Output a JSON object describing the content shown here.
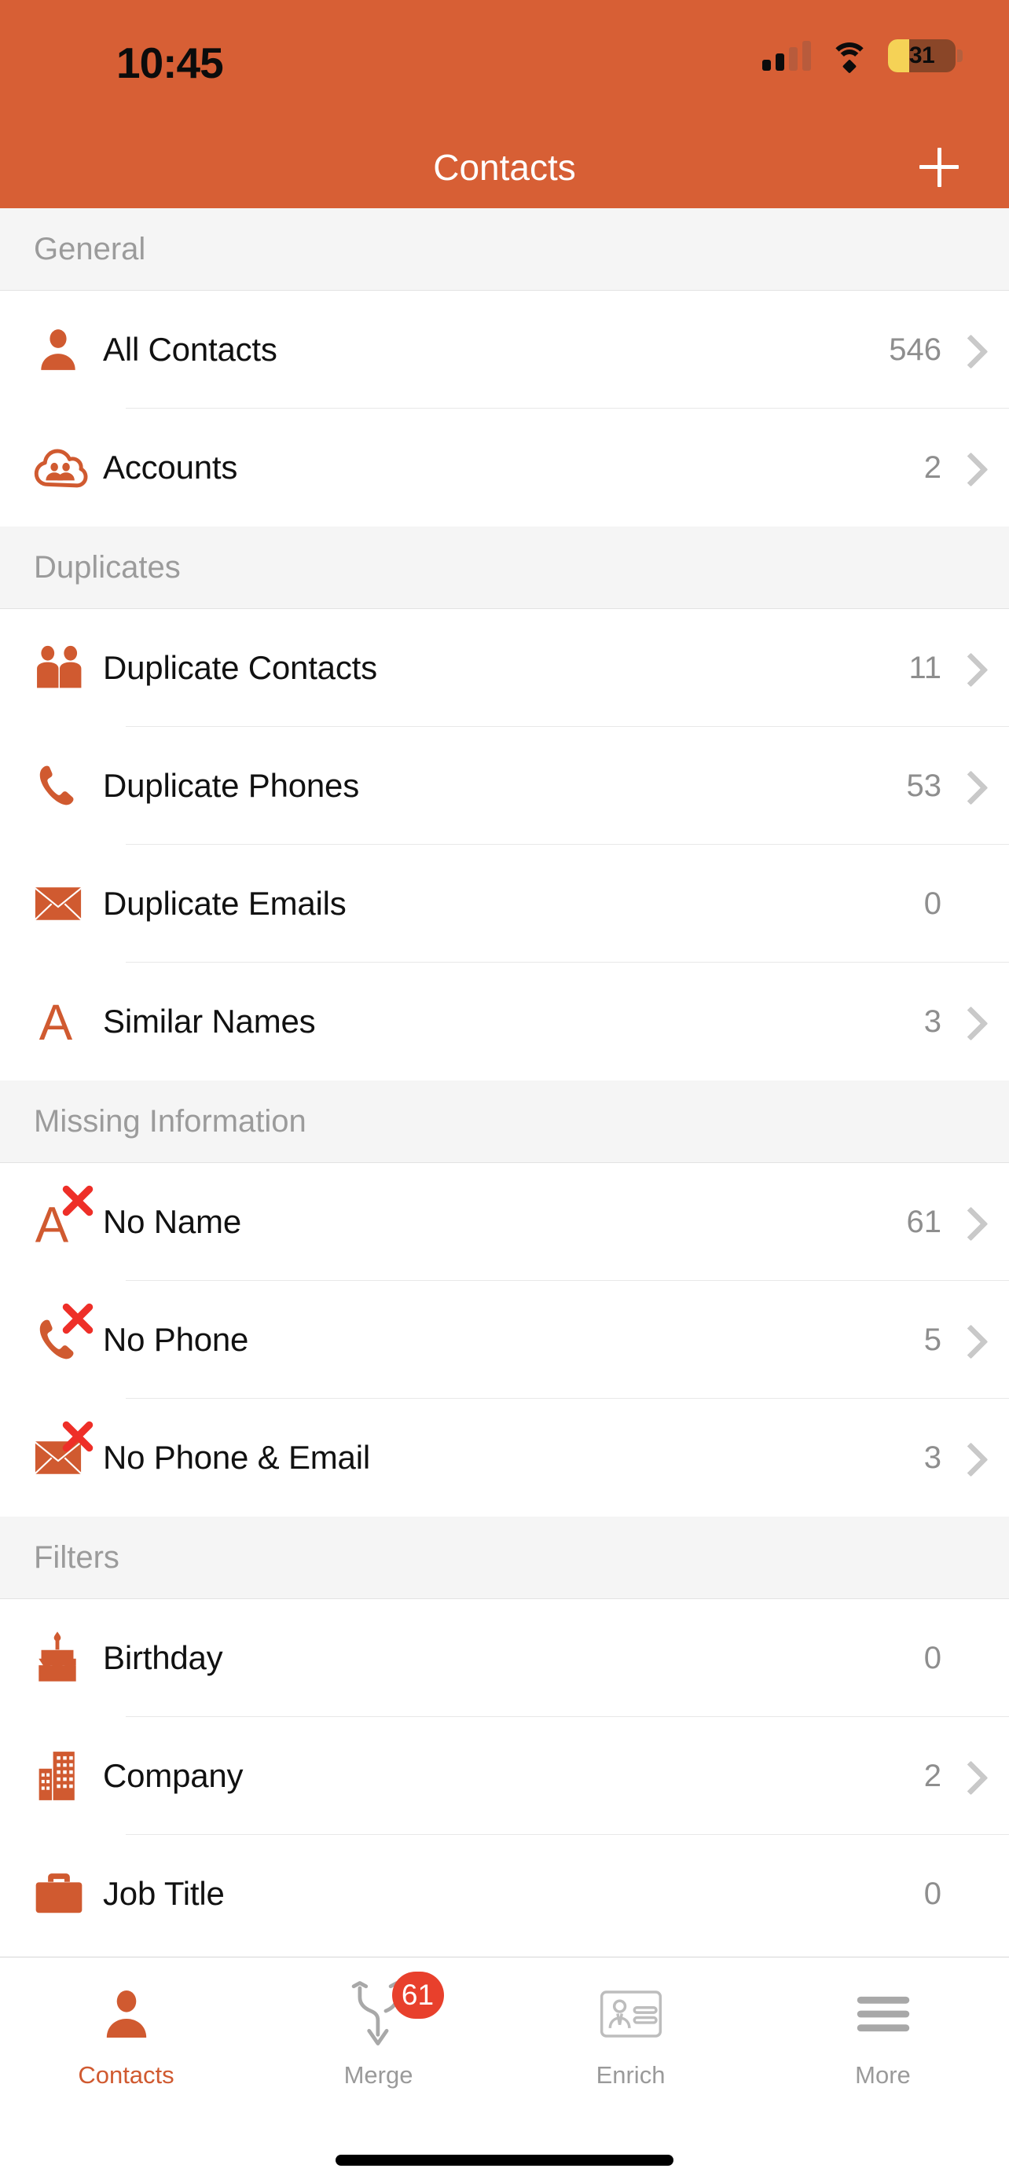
{
  "status_bar": {
    "time": "10:45",
    "cellular_icon": "cellular-signal-icon",
    "cellular_bars_filled": 2,
    "cellular_bars_total": 4,
    "wifi_icon": "wifi-icon",
    "battery_icon": "battery-icon",
    "battery_percent": "31",
    "battery_low_power": true
  },
  "nav_bar": {
    "title": "Contacts",
    "add_icon": "plus-icon"
  },
  "colors": {
    "brand_orange": "#d75f35",
    "icon_orange": "#d05a30",
    "badge_red": "#e8402c",
    "error_red": "#ee2f28",
    "section_bg": "#f5f5f5",
    "secondary_text": "#8e8e8e"
  },
  "sections": [
    {
      "header": "General",
      "rows": [
        {
          "icon": "person-icon",
          "label": "All Contacts",
          "count": "546",
          "chevron": true
        },
        {
          "icon": "cloud-accounts-icon",
          "label": "Accounts",
          "count": "2",
          "chevron": true
        }
      ]
    },
    {
      "header": "Duplicates",
      "rows": [
        {
          "icon": "two-people-icon",
          "label": "Duplicate Contacts",
          "count": "11",
          "chevron": true
        },
        {
          "icon": "phone-icon",
          "label": "Duplicate Phones",
          "count": "53",
          "chevron": true
        },
        {
          "icon": "envelope-icon",
          "label": "Duplicate Emails",
          "count": "0",
          "chevron": false
        },
        {
          "icon": "letter-a-icon",
          "label": "Similar Names",
          "count": "3",
          "chevron": true
        }
      ]
    },
    {
      "header": "Missing Information",
      "rows": [
        {
          "icon": "letter-a-error-icon",
          "label": "No Name",
          "count": "61",
          "chevron": true
        },
        {
          "icon": "phone-error-icon",
          "label": "No Phone",
          "count": "5",
          "chevron": true
        },
        {
          "icon": "envelope-error-icon",
          "label": "No Phone & Email",
          "count": "3",
          "chevron": true
        }
      ]
    },
    {
      "header": "Filters",
      "rows": [
        {
          "icon": "birthday-cake-icon",
          "label": "Birthday",
          "count": "0",
          "chevron": false
        },
        {
          "icon": "building-icon",
          "label": "Company",
          "count": "2",
          "chevron": true
        },
        {
          "icon": "briefcase-icon",
          "label": "Job Title",
          "count": "0",
          "chevron": false
        }
      ]
    }
  ],
  "tab_bar": {
    "tabs": [
      {
        "icon": "person-icon",
        "label": "Contacts",
        "active": true,
        "badge": null
      },
      {
        "icon": "merge-arrow-icon",
        "label": "Merge",
        "active": false,
        "badge": "61"
      },
      {
        "icon": "contact-card-icon",
        "label": "Enrich",
        "active": false,
        "badge": null
      },
      {
        "icon": "hamburger-menu-icon",
        "label": "More",
        "active": false,
        "badge": null
      }
    ]
  }
}
